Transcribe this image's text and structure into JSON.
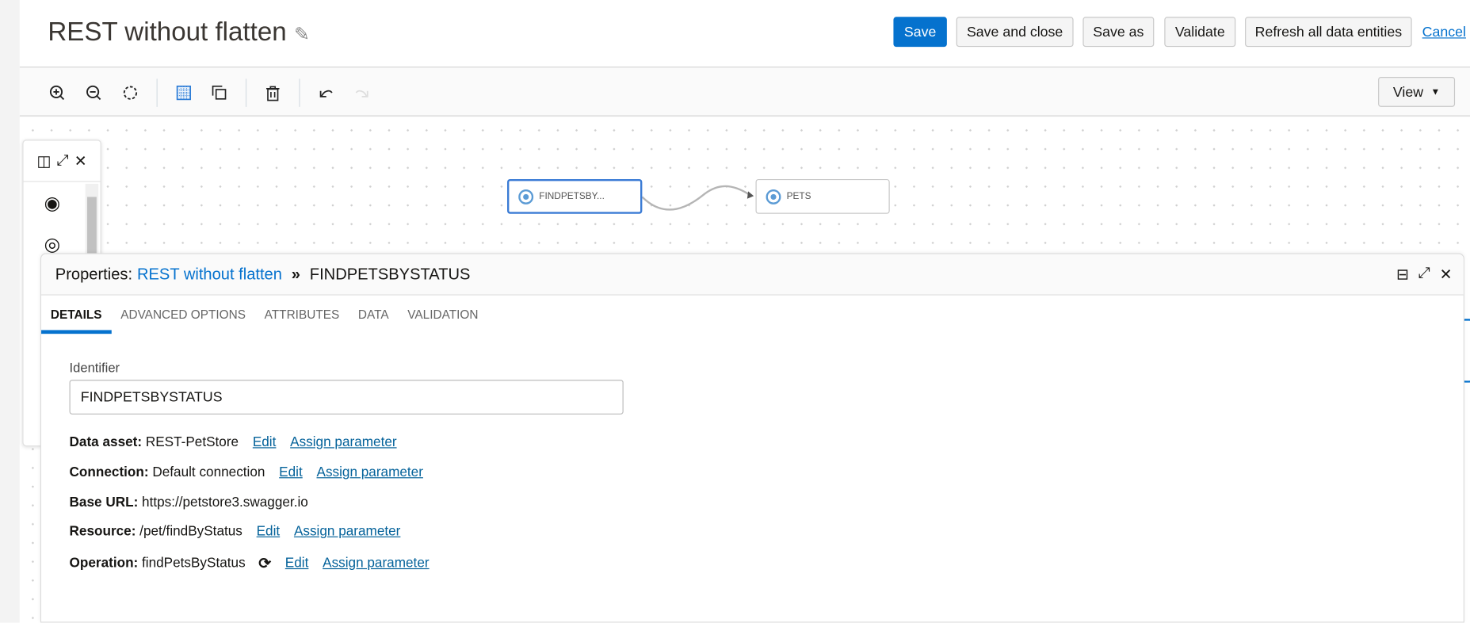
{
  "header": {
    "title": "REST without flatten",
    "buttons": {
      "save": "Save",
      "save_close": "Save and close",
      "save_as": "Save as",
      "validate": "Validate",
      "refresh": "Refresh all data entities",
      "cancel": "Cancel"
    }
  },
  "toolbar": {
    "view_label": "View"
  },
  "canvas": {
    "nodes": [
      {
        "label": "FINDPETSBY..."
      },
      {
        "label": "PETS"
      }
    ]
  },
  "properties": {
    "prefix": "Properties:",
    "parent_link": "REST without flatten",
    "separator": "»",
    "current": "FINDPETSBYSTATUS",
    "tabs": [
      "DETAILS",
      "ADVANCED OPTIONS",
      "ATTRIBUTES",
      "DATA",
      "VALIDATION"
    ],
    "identifier_label": "Identifier",
    "identifier_value": "FINDPETSBYSTATUS",
    "fields": [
      {
        "label": "Data asset:",
        "value": "REST-PetStore",
        "edit": "Edit",
        "assign": "Assign parameter"
      },
      {
        "label": "Connection:",
        "value": "Default connection",
        "edit": "Edit",
        "assign": "Assign parameter"
      },
      {
        "label": "Base URL:",
        "value": "https://petstore3.swagger.io"
      },
      {
        "label": "Resource:",
        "value": "/pet/findByStatus",
        "edit": "Edit",
        "assign": "Assign parameter"
      },
      {
        "label": "Operation:",
        "value": "findPetsByStatus",
        "edit": "Edit",
        "assign": "Assign parameter"
      }
    ]
  },
  "colors": {
    "accent": "#0572ce",
    "link": "#04629a"
  }
}
